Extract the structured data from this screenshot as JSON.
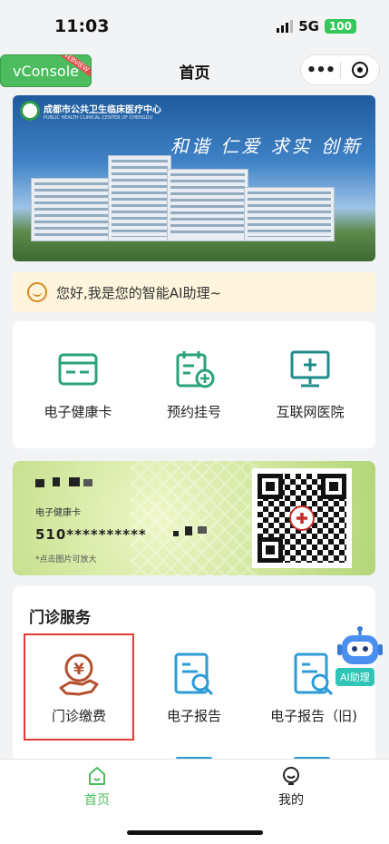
{
  "status_bar": {
    "time": "11:03",
    "network": "5G",
    "battery": "100"
  },
  "nav": {
    "vconsole_label": "vConsole",
    "vconsole_ribbon": "WEBVIEW",
    "title": "首页",
    "more_label": "•••"
  },
  "banner": {
    "hospital_name": "成都市公共卫生临床医疗中心",
    "hospital_name_en": "PUBLIC HEALTH CLINICAL CENTER OF CHENGDU",
    "slogan": "和谐 仁爱 求实 创新"
  },
  "ai_assistant": {
    "greeting": "您好,我是您的智能AI助理~",
    "float_label": "AI助理"
  },
  "quick_services": [
    {
      "label": "电子健康卡",
      "icon": "health-card-icon"
    },
    {
      "label": "预约挂号",
      "icon": "calendar-add-icon"
    },
    {
      "label": "互联网医院",
      "icon": "monitor-plus-icon"
    }
  ],
  "health_card": {
    "card_label": "电子健康卡",
    "card_number": "510**********",
    "hint": "*点击图片可放大"
  },
  "clinic": {
    "title": "门诊服务",
    "items": [
      {
        "label": "门诊缴费",
        "icon": "payment-icon"
      },
      {
        "label": "电子报告",
        "icon": "report-icon"
      },
      {
        "label": "电子报告（旧)",
        "icon": "report-old-icon"
      }
    ]
  },
  "tabbar": {
    "home": "首页",
    "mine": "我的"
  },
  "colors": {
    "primary_green": "#4cbc5e",
    "icon_teal": "#2aa37a",
    "monitor_teal": "#1e8c8c",
    "report_blue": "#2c9bd6",
    "payment_brown": "#b5502f",
    "highlight_red": "#e53935"
  }
}
